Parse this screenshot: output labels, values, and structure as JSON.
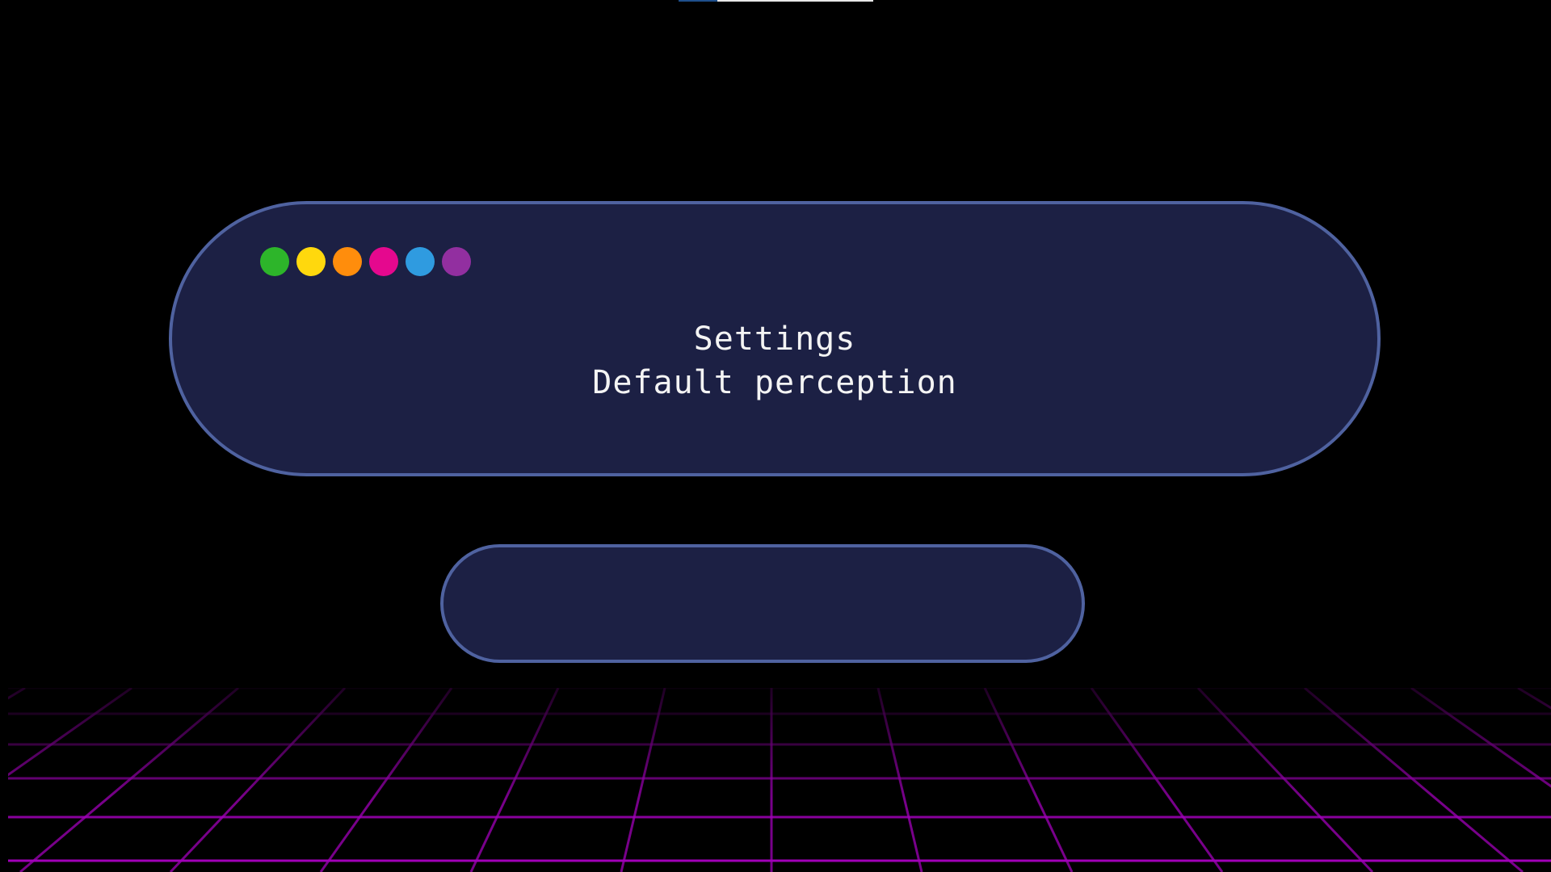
{
  "top_progress": {
    "fill_fraction": 0.2
  },
  "panel": {
    "title": "Settings",
    "subtitle": "Default perception",
    "dots": [
      {
        "name": "green-dot",
        "color": "#2db52a"
      },
      {
        "name": "yellow-dot",
        "color": "#ffd80d"
      },
      {
        "name": "orange-dot",
        "color": "#ff8d0c"
      },
      {
        "name": "magenta-dot",
        "color": "#e5088e"
      },
      {
        "name": "blue-dot",
        "color": "#2f9be0"
      },
      {
        "name": "purple-dot",
        "color": "#922fa0"
      }
    ]
  },
  "colors": {
    "background": "#000000",
    "panel_fill": "#1c2044",
    "panel_border": "#4f62a0",
    "text": "#f4f4f4",
    "grid": "#a000b8"
  }
}
